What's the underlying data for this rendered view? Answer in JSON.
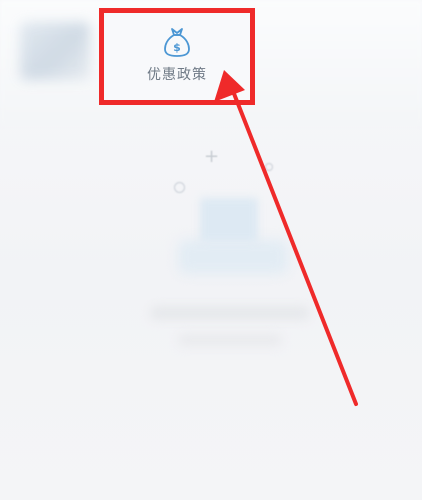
{
  "policy_button": {
    "label": "优惠政策",
    "icon": "money-bag-icon"
  },
  "annotation": {
    "highlight_color": "#ef2a2a",
    "arrow_color": "#ef2a2a"
  }
}
